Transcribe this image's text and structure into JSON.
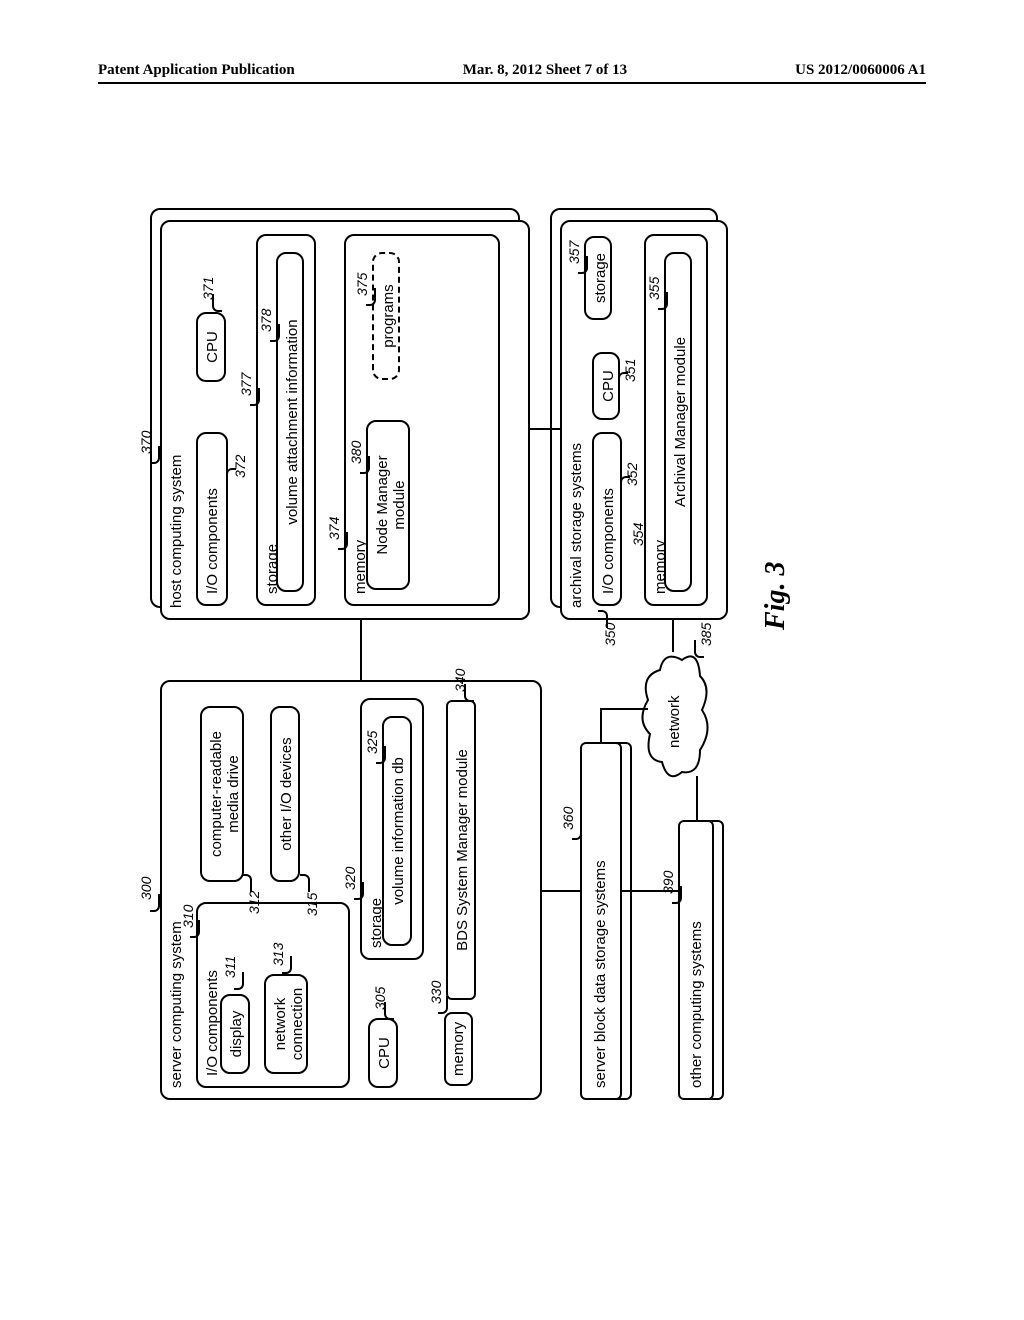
{
  "header": {
    "left": "Patent Application Publication",
    "center": "Mar. 8, 2012  Sheet 7 of 13",
    "right": "US 2012/0060006 A1"
  },
  "figure_label": "Fig. 3",
  "server_system": {
    "title": "server computing system",
    "ref": "300",
    "io": {
      "title": "I/O components",
      "ref": "310"
    },
    "display": {
      "label": "display",
      "ref": "311"
    },
    "network": {
      "label": "network connection",
      "ref": "313"
    },
    "media": {
      "label": "computer-readable media drive",
      "ref": "312"
    },
    "other_io": {
      "label": "other I/O devices",
      "ref": "315"
    },
    "cpu": {
      "label": "CPU",
      "ref": "305"
    },
    "storage": {
      "label": "storage",
      "ref": "320"
    },
    "voldb": {
      "label": "volume information db",
      "ref": "325"
    },
    "memory": {
      "label": "memory",
      "ref": "330"
    },
    "bds": {
      "label": "BDS System Manager module",
      "ref": "340"
    }
  },
  "host_system": {
    "title": "host computing system",
    "ref": "370",
    "io": {
      "label": "I/O components",
      "ref": "372"
    },
    "cpu": {
      "label": "CPU",
      "ref": "371"
    },
    "storage": {
      "label": "storage",
      "ref": "377"
    },
    "vai": {
      "label": "volume attachment information",
      "ref": "378"
    },
    "memory": {
      "label": "memory",
      "ref": "374"
    },
    "node_mgr": {
      "label": "Node Manager module",
      "ref": "380"
    },
    "programs": {
      "label": "programs",
      "ref": "375"
    }
  },
  "archival_system": {
    "title": "archival storage systems",
    "ref": "350",
    "io": {
      "label": "I/O components",
      "ref": "352"
    },
    "cpu": {
      "label": "CPU",
      "ref": "351"
    },
    "storage": {
      "label": "storage",
      "ref": "357"
    },
    "memory": {
      "label": "memory",
      "ref": "354"
    },
    "arch_mgr": {
      "label": "Archival Manager module",
      "ref": "355"
    }
  },
  "sbd": {
    "label": "server block data storage systems",
    "ref": "360"
  },
  "ocs": {
    "label": "other computing systems",
    "ref": "390"
  },
  "network": {
    "label": "network",
    "ref": "385"
  }
}
